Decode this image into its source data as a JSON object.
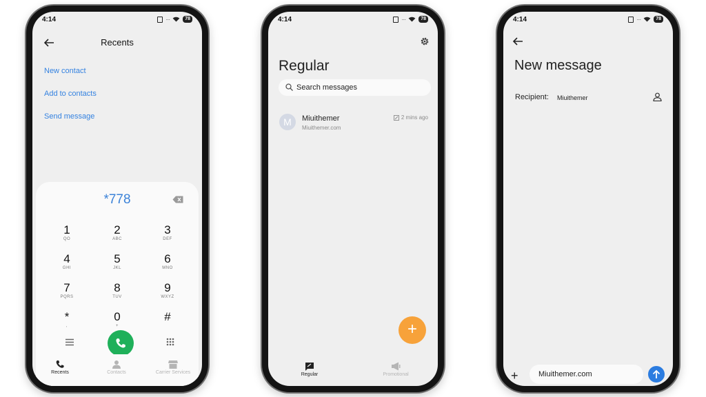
{
  "status_bar": {
    "time": "4:14",
    "battery": "78"
  },
  "dialer": {
    "header": {
      "title": "Recents"
    },
    "actions": [
      "New contact",
      "Add to contacts",
      "Send message"
    ],
    "dialed_number": "*778",
    "keys": [
      {
        "digit": "1",
        "letters": "QO"
      },
      {
        "digit": "2",
        "letters": "ABC"
      },
      {
        "digit": "3",
        "letters": "DEF"
      },
      {
        "digit": "4",
        "letters": "GHI"
      },
      {
        "digit": "5",
        "letters": "JKL"
      },
      {
        "digit": "6",
        "letters": "MNO"
      },
      {
        "digit": "7",
        "letters": "PQRS"
      },
      {
        "digit": "8",
        "letters": "TUV"
      },
      {
        "digit": "9",
        "letters": "WXYZ"
      },
      {
        "digit": "*",
        "letters": ","
      },
      {
        "digit": "0",
        "letters": "+"
      },
      {
        "digit": "#",
        "letters": ""
      }
    ],
    "tabs": [
      {
        "label": "Recents",
        "icon": "phone-icon",
        "active": true
      },
      {
        "label": "Contacts",
        "icon": "person-icon",
        "active": false
      },
      {
        "label": "Carrier Services",
        "icon": "store-icon",
        "active": false
      }
    ],
    "accent_color": "#3b82d8",
    "call_color": "#1fb05a"
  },
  "messages": {
    "title": "Regular",
    "search_placeholder": "Search messages",
    "conversations": [
      {
        "avatar_letter": "M",
        "name": "Miuithemer",
        "preview": "Miuithemer.com",
        "time": "2 mins ago"
      }
    ],
    "fab_icon": "+",
    "fab_color": "#f7a23a",
    "tabs": [
      {
        "label": "Regular",
        "icon": "chat-icon",
        "active": true
      },
      {
        "label": "Promotional",
        "icon": "megaphone-icon",
        "active": false
      }
    ]
  },
  "new_message": {
    "title": "New message",
    "recipient_label": "Recipient:",
    "recipient_value": "Miuithemer",
    "message_text": "Miuithemer.com",
    "add_icon": "+",
    "send_color": "#2b7ce0"
  }
}
